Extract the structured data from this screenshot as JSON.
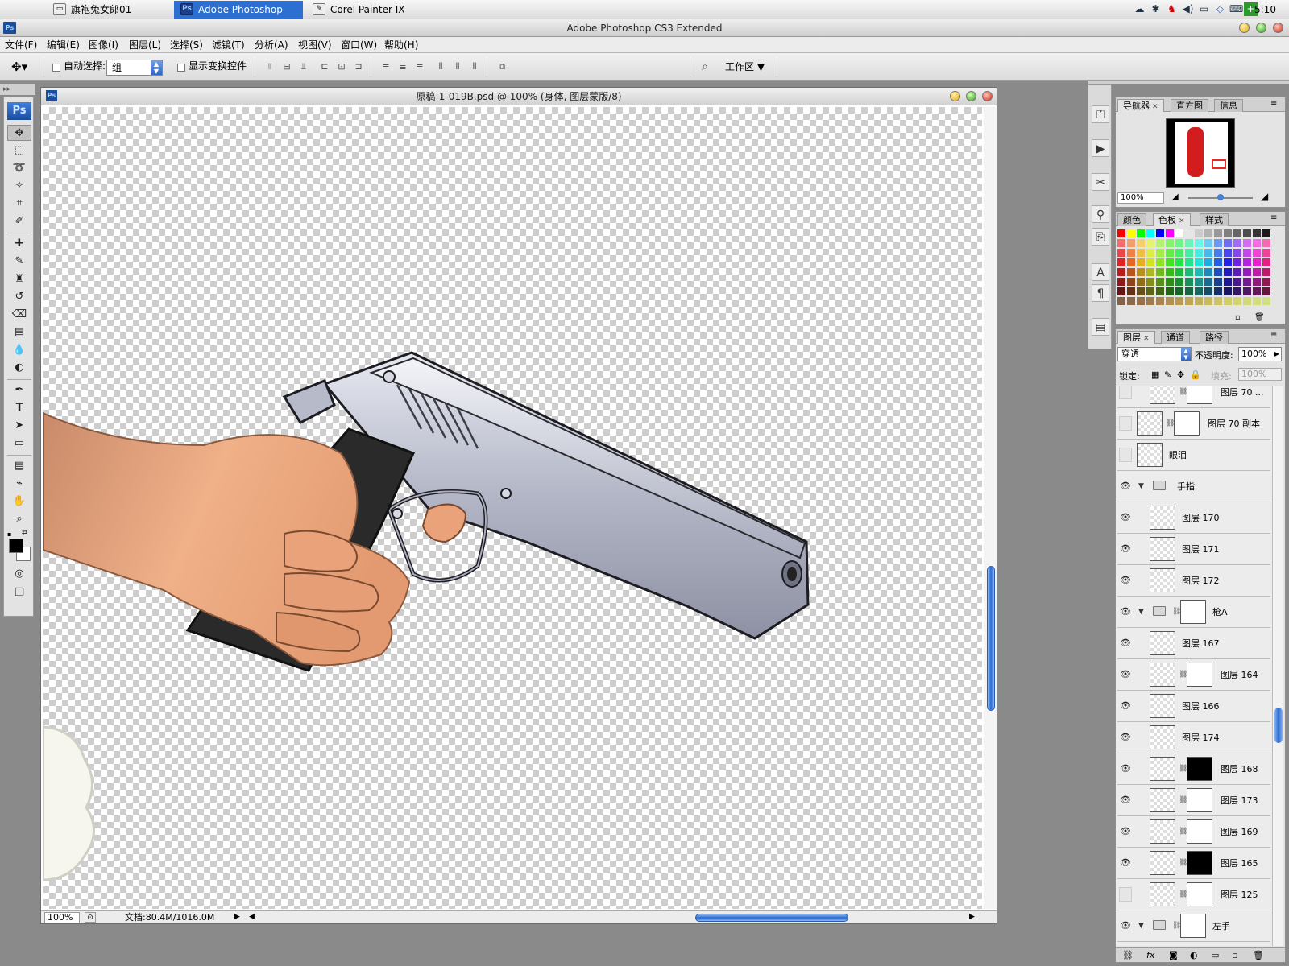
{
  "taskbar": {
    "items": [
      {
        "label": "旗袍兔女郎01",
        "icon": "folder-icon"
      },
      {
        "label": "Adobe Photoshop C...",
        "icon": "photoshop-icon",
        "active": true
      },
      {
        "label": "Corel Painter IX",
        "icon": "painter-icon"
      }
    ],
    "clock": "5:10"
  },
  "app": {
    "title": "Adobe Photoshop CS3 Extended"
  },
  "menu": [
    "文件(F)",
    "编辑(E)",
    "图像(I)",
    "图层(L)",
    "选择(S)",
    "滤镜(T)",
    "分析(A)",
    "视图(V)",
    "窗口(W)",
    "帮助(H)"
  ],
  "options": {
    "auto_select_label": "自动选择:",
    "auto_select_value": "组",
    "show_transform_label": "显示变换控件",
    "workspace_label": "工作区"
  },
  "document": {
    "title": "原稿-1-019B.psd @ 100% (身体, 图层蒙版/8)",
    "zoom": "100%",
    "doc_size": "文档:80.4M/1016.0M"
  },
  "navigator": {
    "tabs": [
      "导航器",
      "直方图",
      "信息"
    ],
    "zoom": "100%"
  },
  "color_panel": {
    "tabs": [
      "颜色",
      "色板",
      "样式"
    ]
  },
  "layers": {
    "tabs": [
      "图层",
      "通道",
      "路径"
    ],
    "blend_mode": "穿透",
    "opacity_label": "不透明度:",
    "opacity": "100%",
    "lock_label": "锁定:",
    "fill_label": "填充:",
    "fill": "100%",
    "rows": [
      {
        "name": "图层 70 ...",
        "visible": false,
        "indent": 1,
        "mask": "white"
      },
      {
        "name": "图层 70 副本",
        "visible": false,
        "indent": 0,
        "mask": "white"
      },
      {
        "name": "眼泪",
        "visible": false,
        "indent": 0,
        "mask": ""
      },
      {
        "name": "手指",
        "visible": true,
        "indent": 0,
        "group": true,
        "mask": ""
      },
      {
        "name": "图层 170",
        "visible": true,
        "indent": 1,
        "mask": ""
      },
      {
        "name": "图层 171",
        "visible": true,
        "indent": 1,
        "mask": ""
      },
      {
        "name": "图层 172",
        "visible": true,
        "indent": 1,
        "mask": ""
      },
      {
        "name": "枪A",
        "visible": true,
        "indent": 0,
        "group": true,
        "mask": "white"
      },
      {
        "name": "图层 167",
        "visible": true,
        "indent": 1,
        "mask": ""
      },
      {
        "name": "图层 164",
        "visible": true,
        "indent": 1,
        "mask": "white"
      },
      {
        "name": "图层 166",
        "visible": true,
        "indent": 1,
        "mask": ""
      },
      {
        "name": "图层 174",
        "visible": true,
        "indent": 1,
        "mask": ""
      },
      {
        "name": "图层 168",
        "visible": true,
        "indent": 1,
        "mask": "black"
      },
      {
        "name": "图层 173",
        "visible": true,
        "indent": 1,
        "mask": "white"
      },
      {
        "name": "图层 169",
        "visible": true,
        "indent": 1,
        "mask": "white"
      },
      {
        "name": "图层 165",
        "visible": true,
        "indent": 1,
        "mask": "black"
      },
      {
        "name": "图层 125",
        "visible": false,
        "indent": 1,
        "mask": "white"
      },
      {
        "name": "左手",
        "visible": true,
        "indent": 0,
        "group": true,
        "mask": "white"
      }
    ]
  },
  "colors": {
    "accent": "#2c6fd1",
    "skin": "#e8a378",
    "gun_metal": "#b9bccb",
    "grip": "#2a2a2a"
  }
}
